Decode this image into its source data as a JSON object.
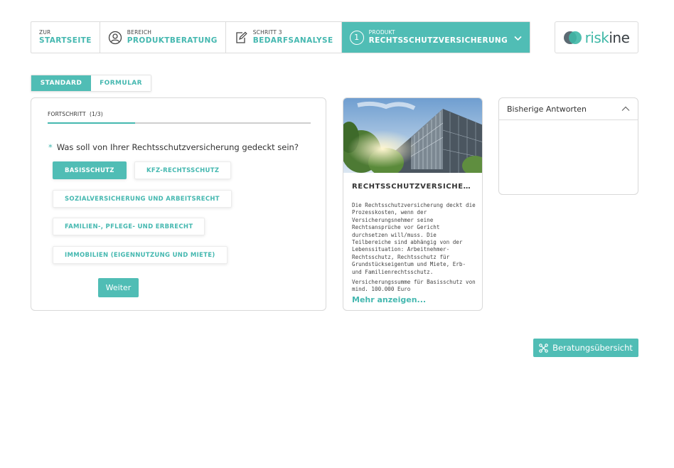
{
  "breadcrumb": {
    "home": {
      "small": "ZUR",
      "big": "STARTSEITE"
    },
    "area": {
      "small": "BEREICH",
      "big": "PRODUKTBERATUNG",
      "icon": "user-circle-icon"
    },
    "step": {
      "small": "SCHRITT 3",
      "big": "BEDARFSANALYSE",
      "icon": "edit-document-icon"
    },
    "product": {
      "small": "PRODUKT",
      "big": "RECHTSSCHUTZVERSICHERUNG",
      "number": "1",
      "icon": "chevron-down-icon"
    }
  },
  "logo": {
    "part1": "risk",
    "part2": "ine"
  },
  "mode": {
    "standard": "STANDARD",
    "formular": "FORMULAR",
    "active": "standard"
  },
  "progress": {
    "label": "FORTSCHRITT",
    "count": "(1/3)",
    "fraction": 0.3333
  },
  "question": {
    "required_mark": "*",
    "text": "Was soll von Ihrer Rechtsschutzversicherung gedeckt sein?",
    "options": [
      {
        "label": "BASISSCHUTZ",
        "selected": true
      },
      {
        "label": "KFZ-RECHTSSCHUTZ",
        "selected": false
      },
      {
        "label": "SOZIALVERSICHERUNG UND ARBEITSRECHT",
        "selected": false
      },
      {
        "label": "FAMILIEN-, PFLEGE- UND ERBRECHT",
        "selected": false
      },
      {
        "label": "IMMOBILIEN (EIGENNUTZUNG UND MIETE)",
        "selected": false
      }
    ],
    "next_label": "Weiter"
  },
  "product": {
    "title": "RECHTSSCHUTZVERSICHER...",
    "description_1": "Die Rechtsschutzversicherung deckt die Prozesskosten, wenn der Versicherungsnehmer seine Rechtsansprüche vor Gericht durchsetzen will/muss. Die Teilbereiche sind abhängig von der Lebenssituation: Arbeitnehmer-Rechtsschutz, Rechtsschutz für Grundstückseigentum und Miete, Erb- und Familienrechtsschutz.",
    "description_2": "Versicherungssumme für Basisschutz von mind. 100.000 Euro",
    "more_label": "Mehr anzeigen..."
  },
  "answers": {
    "title": "Bisherige Antworten",
    "icon": "chevron-up-icon"
  },
  "overview": {
    "label": "Beratungsübersicht",
    "icon": "network-icon"
  },
  "colors": {
    "accent": "#50bdb5",
    "accent_text": "#45b8b0",
    "border": "#d9d9d9"
  }
}
